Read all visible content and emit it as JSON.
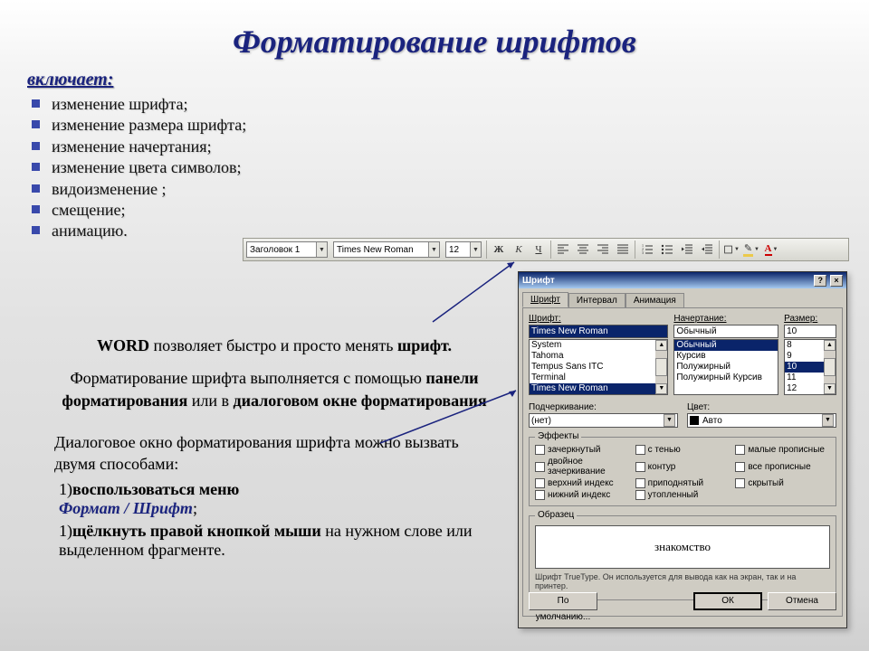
{
  "title": "Форматирование шрифтов",
  "subtitle": "включает:",
  "bullets": [
    "изменение шрифта;",
    "изменение размера шрифта;",
    "изменение начертания;",
    "изменение цвета символов;",
    "видоизменение ;",
    "смещение;",
    "анимацию."
  ],
  "para1_pre": "WORD",
  "para1_mid": " позволяет быстро и просто менять ",
  "para1_post": "шрифт.",
  "para2_a": "Форматирование шрифта выполняется с помощью ",
  "para2_b": "панели форматирования",
  "para2_c": " или в ",
  "para2_d": "диалоговом окне форматирования",
  "para3": "Диалоговое окно форматирования шрифта можно вызвать двумя способами:",
  "step1_num": "1)",
  "step1_a": "воспользоваться меню",
  "menu_format": "Формат",
  "menu_slash": " / ",
  "menu_font": "Шрифт",
  "menu_semi": ";",
  "step2_num": "1)",
  "step2_a": "щёлкнуть правой кнопкой мыши",
  "step2_b": " на нужном слове или выделенном фрагменте.",
  "toolbar": {
    "style": "Заголовок 1",
    "font": "Times New Roman",
    "size": "12",
    "bold": "Ж",
    "italic": "К",
    "underline": "Ч",
    "font_color": "A"
  },
  "dialog": {
    "title": "Шрифт",
    "tab_font": "Шрифт",
    "tab_interval": "Интервал",
    "tab_anim": "Анимация",
    "lbl_font": "Шрифт:",
    "lbl_style": "Начертание:",
    "lbl_size": "Размер:",
    "font_val": "Times New Roman",
    "style_val": "Обычный",
    "size_val": "10",
    "fonts": [
      "System",
      "Tahoma",
      "Tempus Sans ITC",
      "Terminal",
      "Times New Roman"
    ],
    "styles": [
      "Обычный",
      "Курсив",
      "Полужирный",
      "Полужирный Курсив"
    ],
    "sizes": [
      "8",
      "9",
      "10",
      "11",
      "12"
    ],
    "lbl_underline": "Подчеркивание:",
    "underline_val": "(нет)",
    "lbl_color": "Цвет:",
    "color_val": "Авто",
    "frame_effects": "Эффекты",
    "effects": [
      [
        "зачеркнутый",
        "с тенью",
        "малые прописные"
      ],
      [
        "двойное зачеркивание",
        "контур",
        "все прописные"
      ],
      [
        "верхний индекс",
        "приподнятый",
        "скрытый"
      ],
      [
        "нижний индекс",
        "утопленный",
        ""
      ]
    ],
    "frame_preview": "Образец",
    "preview_text": "знакомство",
    "hint": "Шрифт TrueType. Он используется для вывода как на экран, так и на принтер.",
    "btn_default": "По умолчанию...",
    "btn_ok": "ОК",
    "btn_cancel": "Отмена"
  }
}
